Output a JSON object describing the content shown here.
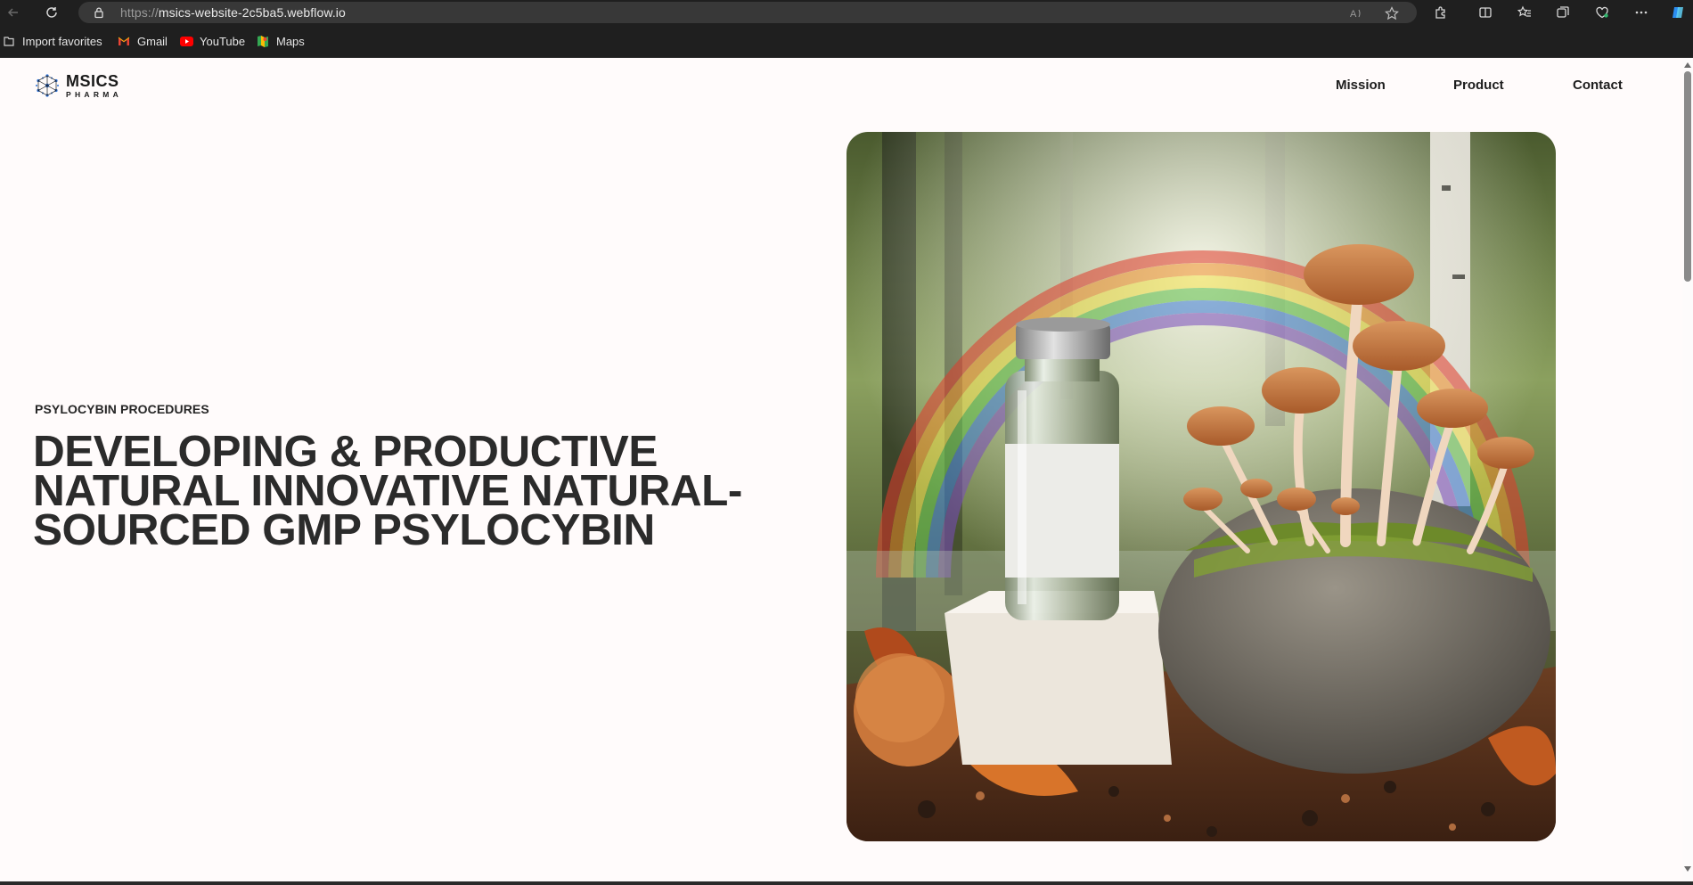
{
  "browser": {
    "url_protocol": "https://",
    "url_host": "msics-website-2c5ba5.webflow.io",
    "bookmarks": [
      {
        "label": "Import favorites",
        "icon": "import-icon"
      },
      {
        "label": "Gmail",
        "icon": "gmail-icon"
      },
      {
        "label": "YouTube",
        "icon": "youtube-icon"
      },
      {
        "label": "Maps",
        "icon": "maps-icon"
      }
    ]
  },
  "site": {
    "logo_name": "MSICS",
    "logo_sub": "PHARMA",
    "nav": {
      "mission": "Mission",
      "product": "Product",
      "contact": "Contact"
    }
  },
  "hero": {
    "eyebrow": "PSYLOCYBIN PROCEDURES",
    "headline_lines": [
      "DEVELOPING & PRODUCTIVE",
      "NATURAL INNOVATIVE NATURAL-",
      "SOURCED GMP PSYLOCYBIN"
    ],
    "image_alt": "Glass vial on a white block beside mushrooms growing on a mossy rock in a forest under a rainbow"
  },
  "colors": {
    "page_bg": "#fffbfb",
    "headline": "#2b2b2b",
    "chrome_bg": "#1f1f1f",
    "logo_accent": "#2a6fd6"
  }
}
